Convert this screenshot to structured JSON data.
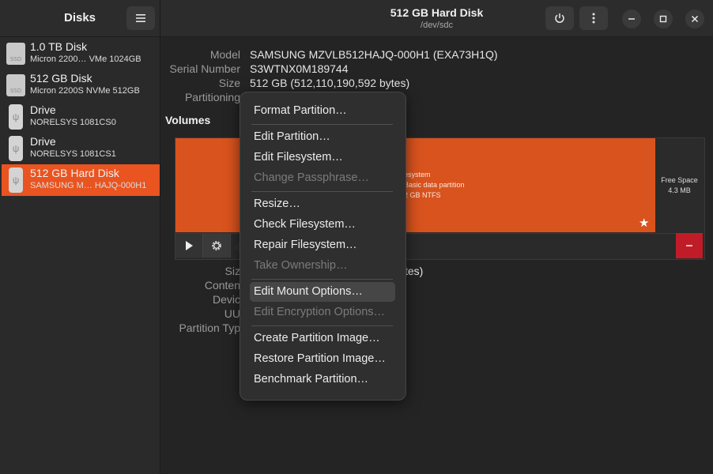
{
  "sidebar": {
    "title": "Disks",
    "disks": [
      {
        "name": "1.0 TB Disk",
        "sub": "Micron 2200… VMe 1024GB",
        "icon": "ssd-icon",
        "icon_label": "SSD"
      },
      {
        "name": "512 GB Disk",
        "sub": "Micron 2200S NVMe 512GB",
        "icon": "ssd-icon",
        "icon_label": "SSD"
      },
      {
        "name": "Drive",
        "sub": "NORELSYS 1081CS0",
        "icon": "usb-drive-icon"
      },
      {
        "name": "Drive",
        "sub": "NORELSYS 1081CS1",
        "icon": "usb-drive-icon"
      },
      {
        "name": "512 GB Hard Disk",
        "sub": "SAMSUNG M… HAJQ-000H1",
        "icon": "usb-drive-icon",
        "selected": true
      }
    ]
  },
  "header": {
    "title": "512 GB Hard Disk",
    "subtitle": "/dev/sdc"
  },
  "drive_info": {
    "model_label": "Model",
    "model_value": "SAMSUNG MZVLB512HAJQ-000H1 (EXA73H1Q)",
    "serial_label": "Serial Number",
    "serial_value": "S3WTNX0M189744",
    "size_label": "Size",
    "size_value": "512 GB (512,110,190,592 bytes)",
    "partitioning_label": "Partitioning"
  },
  "volumes": {
    "heading": "Volumes",
    "partition_lines": [
      "esystem",
      "Basic data partition",
      "2 GB NTFS"
    ],
    "free_space_label": "Free Space",
    "free_space_size": "4.3 MB"
  },
  "details": {
    "size_label_partial": "Siz",
    "size_value_partial": "tes)",
    "contents_label_partial": "Conten",
    "device_label_partial": "Devic",
    "uuid_label_partial": "UU",
    "partition_type_label_partial": "Partition Typ"
  },
  "menu": {
    "items": [
      {
        "label": "Format Partition…",
        "enabled": true
      },
      {
        "label": "Edit Partition…",
        "enabled": true
      },
      {
        "label": "Edit Filesystem…",
        "enabled": true
      },
      {
        "label": "Change Passphrase…",
        "enabled": false
      },
      {
        "label": "Resize…",
        "enabled": true
      },
      {
        "label": "Check Filesystem…",
        "enabled": true
      },
      {
        "label": "Repair Filesystem…",
        "enabled": true
      },
      {
        "label": "Take Ownership…",
        "enabled": false
      },
      {
        "label": "Edit Mount Options…",
        "enabled": true,
        "highlighted": true
      },
      {
        "label": "Edit Encryption Options…",
        "enabled": false
      },
      {
        "label": "Create Partition Image…",
        "enabled": true
      },
      {
        "label": "Restore Partition Image…",
        "enabled": true
      },
      {
        "label": "Benchmark Partition…",
        "enabled": true
      }
    ]
  },
  "colors": {
    "accent": "#e95420",
    "partition": "#d9531e",
    "destructive": "#c01c28"
  }
}
